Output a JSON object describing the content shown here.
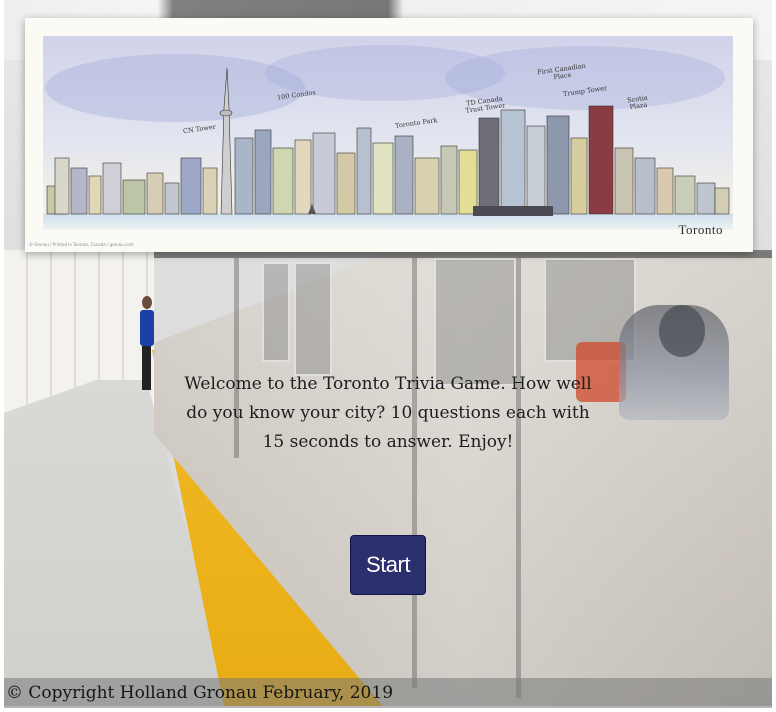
{
  "banner": {
    "caption": "Toronto",
    "credit": "© Gronau / Printed in Toronto, Canada / gronau.com",
    "annotations": [
      "CN Tower",
      "100 Condos",
      "TD Canada Trust Tower",
      "Toronto Park",
      "First Canadian Place",
      "Trump Tower",
      "Scotia Plaza"
    ]
  },
  "welcome": {
    "text": "Welcome to the Toronto Trivia Game. How well do you know your city? 10 questions each with 15 seconds to answer. Enjoy!"
  },
  "start_button": {
    "label": "Start"
  },
  "footer": {
    "copyright": "© Copyright Holland Gronau February, 2019"
  },
  "colors": {
    "button_bg": "#2c2f6e",
    "button_text": "#ffffff",
    "footer_bg": "#787878"
  }
}
